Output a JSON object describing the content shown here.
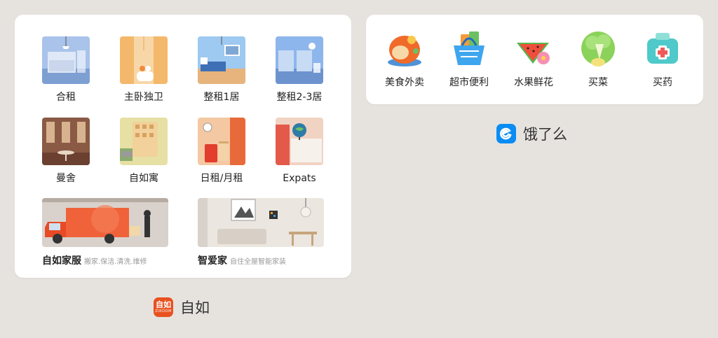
{
  "ziroom": {
    "app_name": "自如",
    "icon_text": "自如",
    "icon_subtext": "ZIROOM",
    "brand_color": "#e8511f",
    "items": [
      {
        "label": "合租",
        "icon": "shared-room-icon"
      },
      {
        "label": "主卧独卫",
        "icon": "master-bedroom-icon"
      },
      {
        "label": "整租1居",
        "icon": "one-bedroom-icon"
      },
      {
        "label": "整租2-3居",
        "icon": "multi-bedroom-icon"
      },
      {
        "label": "曼舍",
        "icon": "mansion-icon"
      },
      {
        "label": "自如寓",
        "icon": "apartment-icon"
      },
      {
        "label": "日租/月租",
        "icon": "short-rent-icon"
      },
      {
        "label": "Expats",
        "icon": "expats-icon"
      }
    ],
    "services": [
      {
        "title": "自如家服",
        "subtitle": "搬家.保洁.清洗.维修",
        "icon": "moving-truck-icon"
      },
      {
        "title": "智爱家",
        "subtitle": "自住全屋智能家装",
        "icon": "smart-home-icon"
      }
    ]
  },
  "eleme": {
    "app_name": "饿了么",
    "icon_text": "饿了么",
    "brand_color": "#0a8cf3",
    "items": [
      {
        "label": "美食外卖",
        "icon": "food-delivery-icon"
      },
      {
        "label": "超市便利",
        "icon": "supermarket-icon"
      },
      {
        "label": "水果鲜花",
        "icon": "fruit-flower-icon"
      },
      {
        "label": "买菜",
        "icon": "vegetables-icon"
      },
      {
        "label": "买药",
        "icon": "medicine-icon"
      }
    ]
  }
}
